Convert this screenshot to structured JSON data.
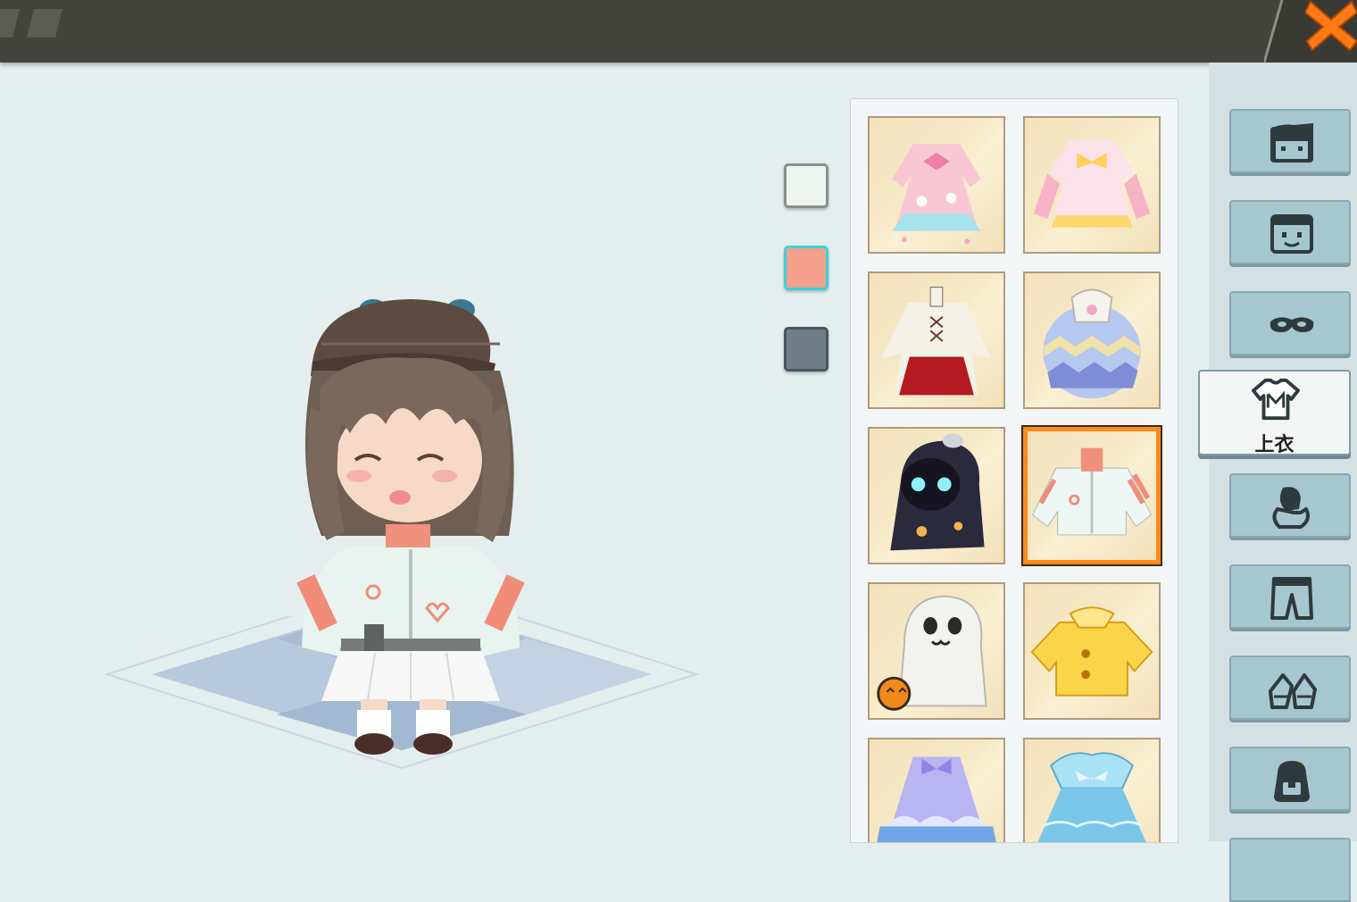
{
  "header": {
    "close_icon": "close-icon",
    "close_color": "#ff7a16"
  },
  "color_swatches": [
    {
      "color": "#eef4ee",
      "selected": false
    },
    {
      "color": "#f5a08c",
      "selected": true
    },
    {
      "color": "#6f7e89",
      "selected": false
    }
  ],
  "items": [
    {
      "icon": "pink-sakura-dress-icon",
      "selected": false
    },
    {
      "icon": "pink-bow-dress-icon",
      "selected": false
    },
    {
      "icon": "white-red-robe-icon",
      "selected": false
    },
    {
      "icon": "easter-egg-costume-icon",
      "selected": false
    },
    {
      "icon": "dark-ghost-cloak-icon",
      "selected": false
    },
    {
      "icon": "white-hoodie-jacket-icon",
      "selected": true
    },
    {
      "icon": "white-ghost-costume-icon",
      "selected": false
    },
    {
      "icon": "yellow-shirt-icon",
      "selected": false
    },
    {
      "icon": "purple-ruffle-dress-icon",
      "selected": false
    },
    {
      "icon": "blue-frill-dress-icon",
      "selected": false
    }
  ],
  "categories": [
    {
      "icon": "hair-icon",
      "label": "",
      "active": false
    },
    {
      "icon": "face-icon",
      "label": "",
      "active": false
    },
    {
      "icon": "mask-icon",
      "label": "",
      "active": false
    },
    {
      "icon": "shirt-icon",
      "label": "上衣",
      "active": true
    },
    {
      "icon": "gloves-icon",
      "label": "",
      "active": false
    },
    {
      "icon": "pants-icon",
      "label": "",
      "active": false
    },
    {
      "icon": "shoes-icon",
      "label": "",
      "active": false
    },
    {
      "icon": "backpack-icon",
      "label": "",
      "active": false
    }
  ]
}
